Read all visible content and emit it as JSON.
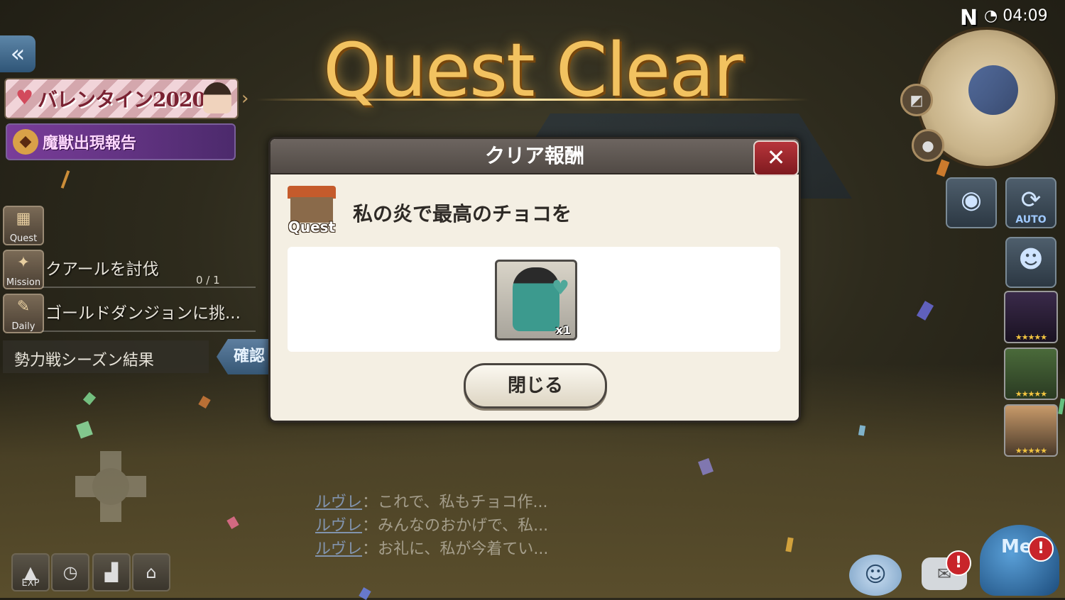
{
  "title": "Quest Clear",
  "status": {
    "compass": "N",
    "time": "04:09"
  },
  "left_panel": {
    "event_banner": "バレンタイン2020",
    "beast_banner": "魔獣出現報告",
    "quests": [
      {
        "tag": "Quest",
        "text": "",
        "progress": ""
      },
      {
        "tag": "Mission",
        "text": "クアールを討伐",
        "progress": "0 / 1"
      },
      {
        "tag": "Daily",
        "text": "ゴールドダンジョンに挑...",
        "progress": ""
      }
    ],
    "faction": "勢力戦シーズン結果",
    "confirm": "確認"
  },
  "dialog": {
    "title": "クリア報酬",
    "quest_tag": "Quest",
    "quest_name": "私の炎で最高のチョコを",
    "reward_qty": "x1",
    "close_label": "閉じる"
  },
  "side_buttons": {
    "auto_label": "AUTO"
  },
  "chat": [
    {
      "who": "ルヴレ",
      "sep": "：",
      "msg": "これで、私もチョコ作..."
    },
    {
      "who": "ルヴレ",
      "sep": "：",
      "msg": "みんなのおかげで、私..."
    },
    {
      "who": "ルヴレ",
      "sep": "：",
      "msg": "お礼に、私が今着てい..."
    }
  ],
  "bottom_icons": {
    "exp_label": "EXP",
    "menu_label": "Me",
    "alert": "!"
  },
  "colors": {
    "title_gold": "#f2c260",
    "dialog_bg": "#f4efe3",
    "close_red": "#b7353b"
  }
}
